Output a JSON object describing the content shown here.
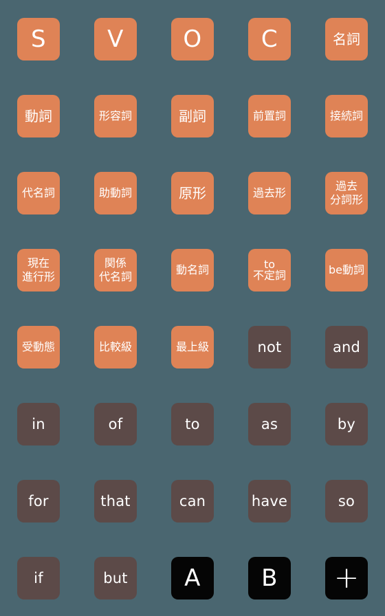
{
  "sheet": {
    "background_color": "#4a6670",
    "columns": 5,
    "rows": 8,
    "tile_colors": {
      "orange": "#df8356",
      "brown": "#5c4a48",
      "black": "#050505"
    },
    "text_color": "#ffffff"
  },
  "tiles": [
    {
      "name": "tile-s",
      "lines": [
        "S"
      ],
      "color": "orange",
      "size": "sz-xl"
    },
    {
      "name": "tile-v",
      "lines": [
        "V"
      ],
      "color": "orange",
      "size": "sz-xl"
    },
    {
      "name": "tile-o",
      "lines": [
        "O"
      ],
      "color": "orange",
      "size": "sz-xl"
    },
    {
      "name": "tile-c",
      "lines": [
        "C"
      ],
      "color": "orange",
      "size": "sz-xl"
    },
    {
      "name": "tile-meishi",
      "lines": [
        "名詞"
      ],
      "color": "orange",
      "size": "sz-ja2"
    },
    {
      "name": "tile-doushi",
      "lines": [
        "動詞"
      ],
      "color": "orange",
      "size": "sz-ja2"
    },
    {
      "name": "tile-keiyoushi",
      "lines": [
        "形容詞"
      ],
      "color": "orange",
      "size": "sz-ja3"
    },
    {
      "name": "tile-fukushi",
      "lines": [
        "副詞"
      ],
      "color": "orange",
      "size": "sz-ja2"
    },
    {
      "name": "tile-zenchishi",
      "lines": [
        "前置詞"
      ],
      "color": "orange",
      "size": "sz-ja3"
    },
    {
      "name": "tile-setsuzokushi",
      "lines": [
        "接続詞"
      ],
      "color": "orange",
      "size": "sz-ja3"
    },
    {
      "name": "tile-daimeishi",
      "lines": [
        "代名詞"
      ],
      "color": "orange",
      "size": "sz-ja3"
    },
    {
      "name": "tile-jodoushi",
      "lines": [
        "助動詞"
      ],
      "color": "orange",
      "size": "sz-ja3"
    },
    {
      "name": "tile-genkei",
      "lines": [
        "原形"
      ],
      "color": "orange",
      "size": "sz-ja2"
    },
    {
      "name": "tile-kakokei",
      "lines": [
        "過去形"
      ],
      "color": "orange",
      "size": "sz-ja3"
    },
    {
      "name": "tile-kako-bunshikei",
      "lines": [
        "過去",
        "分詞形"
      ],
      "color": "orange",
      "size": "sz-stack"
    },
    {
      "name": "tile-genzai-shinkoukei",
      "lines": [
        "現在",
        "進行形"
      ],
      "color": "orange",
      "size": "sz-stack"
    },
    {
      "name": "tile-kankei-daimeishi",
      "lines": [
        "関係",
        "代名詞"
      ],
      "color": "orange",
      "size": "sz-stack"
    },
    {
      "name": "tile-doumeishi",
      "lines": [
        "動名詞"
      ],
      "color": "orange",
      "size": "sz-ja3"
    },
    {
      "name": "tile-to-futeishi",
      "lines": [
        "to",
        "不定詞"
      ],
      "color": "orange",
      "size": "sz-tostack"
    },
    {
      "name": "tile-be-doushi",
      "lines": [
        "be動詞"
      ],
      "color": "orange",
      "size": "sz-mix"
    },
    {
      "name": "tile-judoutai",
      "lines": [
        "受動態"
      ],
      "color": "orange",
      "size": "sz-ja3"
    },
    {
      "name": "tile-hikakukyuu",
      "lines": [
        "比較級"
      ],
      "color": "orange",
      "size": "sz-ja3"
    },
    {
      "name": "tile-saijoukyuu",
      "lines": [
        "最上級"
      ],
      "color": "orange",
      "size": "sz-ja3"
    },
    {
      "name": "tile-not",
      "lines": [
        "not"
      ],
      "color": "brown",
      "size": "sz-lat"
    },
    {
      "name": "tile-and",
      "lines": [
        "and"
      ],
      "color": "brown",
      "size": "sz-lat"
    },
    {
      "name": "tile-in",
      "lines": [
        "in"
      ],
      "color": "brown",
      "size": "sz-lat"
    },
    {
      "name": "tile-of",
      "lines": [
        "of"
      ],
      "color": "brown",
      "size": "sz-lat"
    },
    {
      "name": "tile-to",
      "lines": [
        "to"
      ],
      "color": "brown",
      "size": "sz-lat"
    },
    {
      "name": "tile-as",
      "lines": [
        "as"
      ],
      "color": "brown",
      "size": "sz-lat"
    },
    {
      "name": "tile-by",
      "lines": [
        "by"
      ],
      "color": "brown",
      "size": "sz-lat"
    },
    {
      "name": "tile-for",
      "lines": [
        "for"
      ],
      "color": "brown",
      "size": "sz-lat"
    },
    {
      "name": "tile-that",
      "lines": [
        "that"
      ],
      "color": "brown",
      "size": "sz-lat"
    },
    {
      "name": "tile-can",
      "lines": [
        "can"
      ],
      "color": "brown",
      "size": "sz-lat"
    },
    {
      "name": "tile-have",
      "lines": [
        "have"
      ],
      "color": "brown",
      "size": "sz-lat"
    },
    {
      "name": "tile-so",
      "lines": [
        "so"
      ],
      "color": "brown",
      "size": "sz-lat"
    },
    {
      "name": "tile-if",
      "lines": [
        "if"
      ],
      "color": "brown",
      "size": "sz-lat"
    },
    {
      "name": "tile-but",
      "lines": [
        "but"
      ],
      "color": "brown",
      "size": "sz-lat"
    },
    {
      "name": "tile-a",
      "lines": [
        "A"
      ],
      "color": "black",
      "size": "sz-xl"
    },
    {
      "name": "tile-b",
      "lines": [
        "B"
      ],
      "color": "black",
      "size": "sz-xl"
    },
    {
      "name": "tile-plus",
      "lines": [
        "+"
      ],
      "color": "black",
      "size": "sz-xl",
      "icon": "plus-icon"
    }
  ]
}
